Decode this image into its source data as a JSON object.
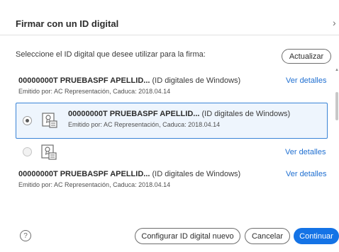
{
  "dialog": {
    "title": "Firmar con un ID digital",
    "close_glyph": "›",
    "instruction": "Seleccione el ID digital que desee utilizar para la firma:",
    "update_button": "Actualizar"
  },
  "certificates": [
    {
      "name": "00000000T PRUEBASPF APELLID...",
      "type": "(ID digitales de Windows)",
      "issuer": "Emitido por: AC Representación, Caduca: 2018.04.14",
      "details_link": "Ver detalles",
      "selected": false
    },
    {
      "name": "00000000T PRUEBASPF APELLID...",
      "type": "(ID digitales de Windows)",
      "issuer": "Emitido por: AC Representación, Caduca: 2018.04.14",
      "details_link": "",
      "selected": true
    },
    {
      "name": "",
      "type": "",
      "issuer": "",
      "details_link": "Ver detalles",
      "selected": false
    },
    {
      "name": "00000000T PRUEBASPF APELLID...",
      "type": "(ID digitales de Windows)",
      "issuer": "Emitido por: AC Representación, Caduca: 2018.04.14",
      "details_link": "Ver detalles",
      "selected": false
    }
  ],
  "footer": {
    "help_glyph": "?",
    "configure_button": "Configurar ID digital nuevo",
    "cancel_button": "Cancelar",
    "continue_button": "Continuar"
  },
  "colors": {
    "accent": "#1473e6",
    "link": "#1f6fd1",
    "selected_border": "#3a84d6",
    "selected_bg": "#eef5fd"
  },
  "icons": {
    "certificate": "certificate-icon",
    "help": "help-icon",
    "close": "chevron-right-icon"
  }
}
